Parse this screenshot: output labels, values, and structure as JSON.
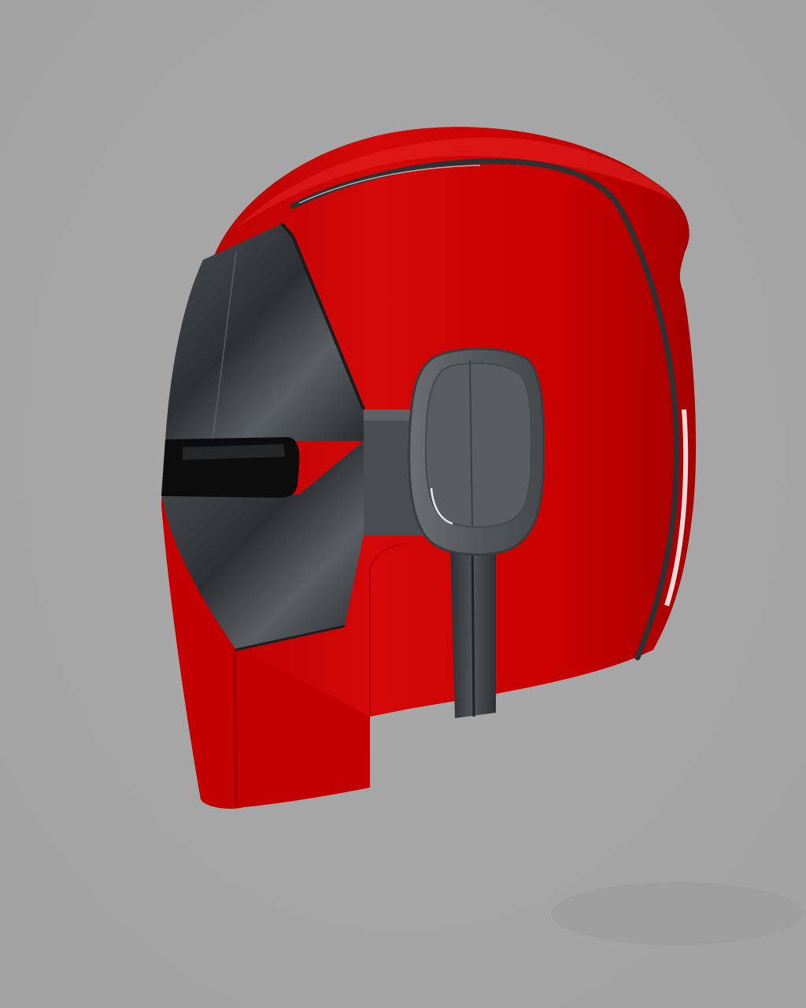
{
  "scene": {
    "subject": "helmet-render",
    "colors": {
      "background": "#a6a6a6",
      "shell_red": "#c80000",
      "shell_red_dark": "#8a0000",
      "shell_red_light": "#e21414",
      "faceplate_dark": "#2a2d30",
      "faceplate_mid": "#4a4e52",
      "visor_black": "#0c0c0d",
      "ear_gray": "#5d6165",
      "ear_gray_dark": "#3e4246",
      "trim_gray": "#3a3d40",
      "highlight": "#ffffff"
    }
  }
}
